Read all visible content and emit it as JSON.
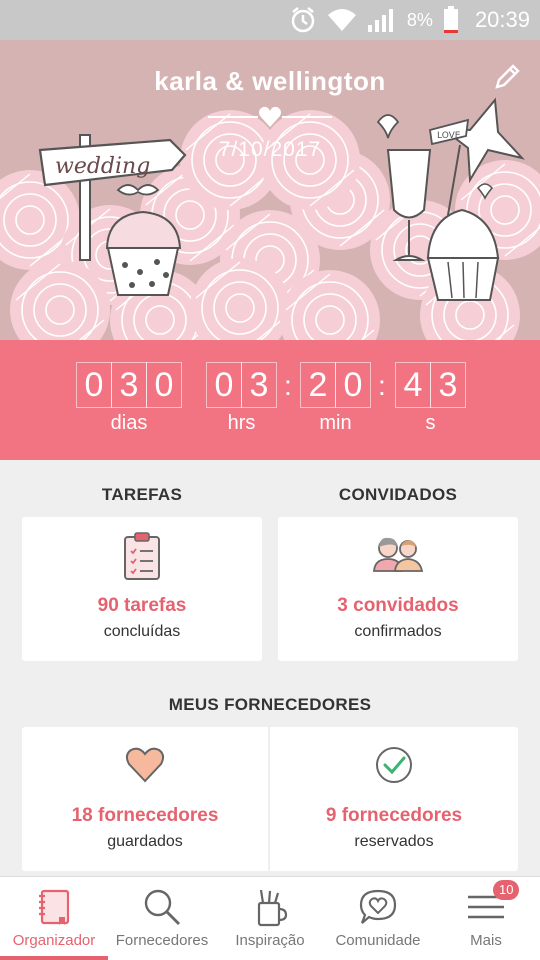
{
  "status_bar": {
    "icons": [
      "alarm-icon",
      "wifi-icon",
      "signal-icon",
      "battery-icon"
    ],
    "battery": "8%",
    "time": "20:39"
  },
  "hero": {
    "names": "karla & wellington",
    "date": "7/10/2017",
    "sign_text": "wedding",
    "flag_text": "LOVE"
  },
  "countdown": {
    "days": [
      "0",
      "3",
      "0"
    ],
    "hours": [
      "0",
      "3"
    ],
    "minutes": [
      "2",
      "0"
    ],
    "seconds": [
      "4",
      "3"
    ],
    "labels": {
      "days": "dias",
      "hours": "hrs",
      "minutes": "min",
      "seconds": "s"
    }
  },
  "tasks": {
    "title": "TAREFAS",
    "count": "90 tarefas",
    "sub": "concluídas"
  },
  "guests": {
    "title": "CONVIDADOS",
    "count": "3 convidados",
    "sub": "confirmados"
  },
  "vendors": {
    "title": "MEUS FORNECEDORES",
    "saved": {
      "count": "18 fornecedores",
      "sub": "guardados"
    },
    "booked": {
      "count": "9 fornecedores",
      "sub": "reservados"
    }
  },
  "nav": {
    "items": [
      {
        "label": "Organizador",
        "icon": "notebook-icon"
      },
      {
        "label": "Fornecedores",
        "icon": "search-icon"
      },
      {
        "label": "Inspiração",
        "icon": "pencil-cup-icon"
      },
      {
        "label": "Comunidade",
        "icon": "chat-heart-icon"
      },
      {
        "label": "Mais",
        "icon": "menu-icon"
      }
    ],
    "badge": "10"
  },
  "colors": {
    "accent": "#f27382",
    "accent_text": "#e5636f",
    "hero_bg": "#d6b3b3"
  }
}
